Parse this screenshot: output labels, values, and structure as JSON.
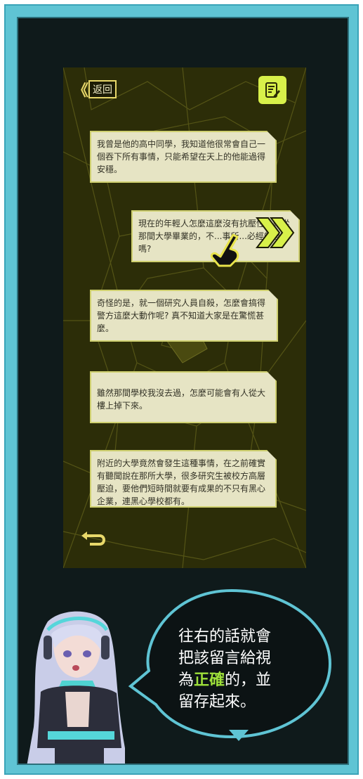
{
  "header": {
    "back_label": "返回",
    "back_chevron": "《",
    "note_icon": "note-edit-icon"
  },
  "messages": [
    {
      "text": "我曾是他的高中同學，我知道他很常會自己一個吞下所有事情，只能希望在天上的他能過得安穩。"
    },
    {
      "text": "現在的年輕人怎麼這麼沒有抗壓性...就從那間大學畢業的，不...事所...必經的過程嗎?"
    },
    {
      "text": "奇怪的是，就一個研究人員自殺，怎麼會搞得警方這麼大動作呢? 真不知道大家是在驚慌甚麼。"
    },
    {
      "text": "雖然那間學校我沒去過，怎麼可能會有人從大樓上掉下來。"
    },
    {
      "text": "附近的大學竟然會發生這種事情，在之前確實有聽聞說在那所大學，很多研究生被校方高層壓迫，要他們短時間就要有成果的不只有黑心企業，連黑心學校都有。"
    }
  ],
  "tutorial": {
    "line1": "往右的話就會",
    "line2": "把該留言給視",
    "line3_prefix": "為",
    "line3_highlight": "正確",
    "line3_suffix": "的，並",
    "line4": "留存起來。"
  },
  "colors": {
    "accent": "#d8f04a",
    "frame": "#5fc4d4",
    "highlight": "#9ee03a"
  },
  "icons": [
    "swipe-right-arrows-icon",
    "pointing-hand-icon",
    "undo-icon",
    "triangle-down-icon"
  ]
}
